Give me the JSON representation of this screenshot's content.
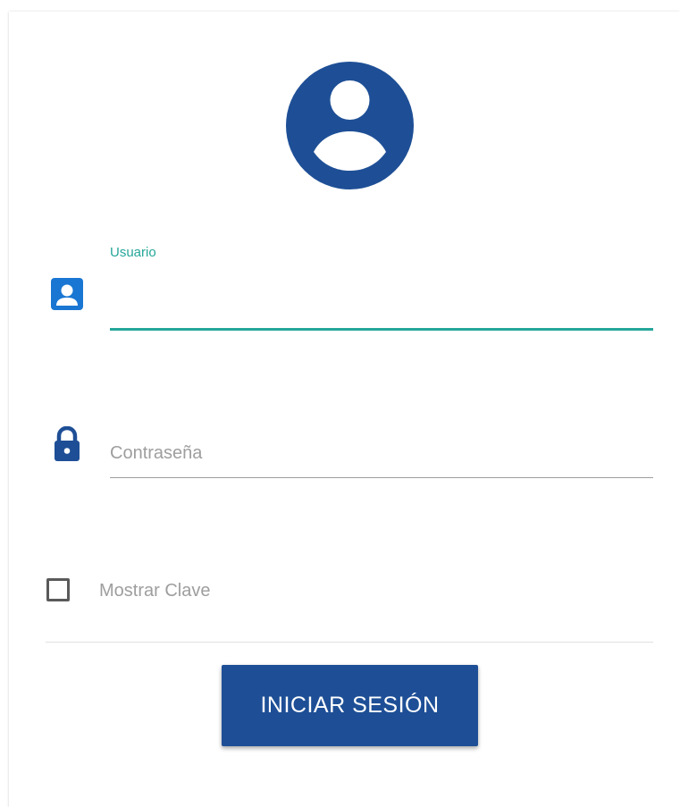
{
  "login": {
    "avatar_icon": "account-circle-icon",
    "username": {
      "label": "Usuario",
      "value": "",
      "icon": "account-box-icon"
    },
    "password": {
      "placeholder": "Contraseña",
      "value": "",
      "icon": "lock-icon"
    },
    "show_password": {
      "label": "Mostrar Clave",
      "checked": false
    },
    "submit_label": "INICIAR SESIÓN"
  },
  "colors": {
    "primary": "#1e4f96",
    "accent": "#26a69a",
    "icon_blue": "#1976d2"
  }
}
